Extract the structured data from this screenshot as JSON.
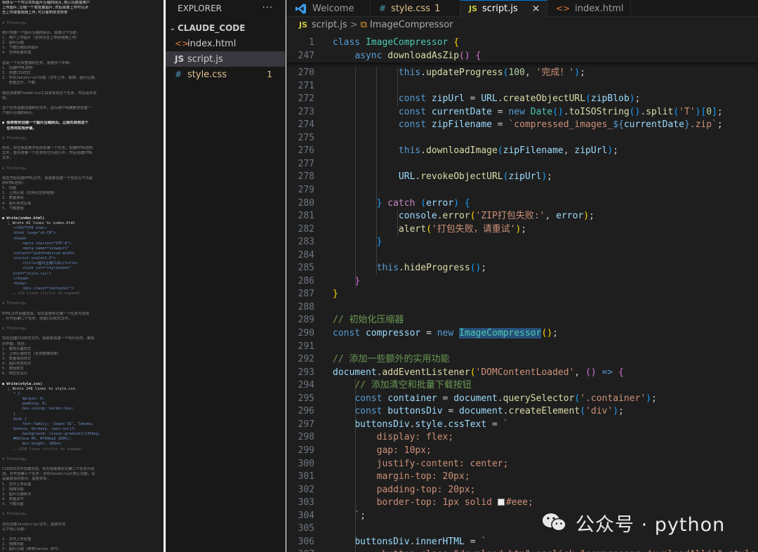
{
  "terminal": {
    "lines": [
      {
        "t": "我想写一个可以实现图片压缩的网页,核心功能需用户",
        "s": "st"
      },
      {
        "t": "上传图片,压缩一个或批量图片,然后需要上传可以点",
        "s": "st"
      },
      {
        "t": "击上传或者拖拽上传,可以看到预览效果",
        "s": "st"
      },
      {
        "t": "",
        "s": ""
      },
      {
        "t": "✻ Thinking…",
        "s": "dm"
      },
      {
        "t": "",
        "s": ""
      },
      {
        "t": "用户想要一个图片压缩的网页，需要以下功能:",
        "s": ""
      },
      {
        "t": "1. 用户上传图片（支持点击上传和拖拽上传）",
        "s": ""
      },
      {
        "t": "2. 图片压缩",
        "s": ""
      },
      {
        "t": "3. 下载压缩后的图片",
        "s": ""
      },
      {
        "t": "4. 支持批量处理",
        "s": ""
      },
      {
        "t": "",
        "s": ""
      },
      {
        "t": "这是一个比较直接的任务，需要多个步骤:",
        "s": ""
      },
      {
        "t": "1. 创建HTML结构",
        "s": ""
      },
      {
        "t": "2. 创建CSS样式",
        "s": ""
      },
      {
        "t": "3. 实现JavaScript功能（文件上传、拖拽、图片压缩、",
        "s": ""
      },
      {
        "t": "   质量显示、下载）",
        "s": ""
      },
      {
        "t": "",
        "s": ""
      },
      {
        "t": "我应该使用TodoWrite工具来规划这个任务，然后逐步实",
        "s": ""
      },
      {
        "t": "现。",
        "s": ""
      },
      {
        "t": "",
        "s": ""
      },
      {
        "t": "这个任务需要创建新的文件，因为用户明确要求创建一",
        "s": ""
      },
      {
        "t": "个图片压缩的网页。",
        "s": ""
      },
      {
        "t": "",
        "s": ""
      },
      {
        "t": "● 我将帮你创建一个图片压缩网页。让我先规划这个",
        "s": "hd"
      },
      {
        "t": "  任务的实现步骤。",
        "s": "hd"
      },
      {
        "t": "",
        "s": ""
      },
      {
        "t": "✻ Thinking…",
        "s": "dm"
      },
      {
        "t": "",
        "s": ""
      },
      {
        "t": "好的，现在我需要开始实现第一个任务，创建HTML结构",
        "s": ""
      },
      {
        "t": "文件。首先将第一个任务标记为进行中，然后创建HTML",
        "s": ""
      },
      {
        "t": "文件。",
        "s": ""
      },
      {
        "t": "",
        "s": ""
      },
      {
        "t": "✻ Thinking…",
        "s": "dm"
      },
      {
        "t": "",
        "s": ""
      },
      {
        "t": "现在开始创建HTML文件。我需要创建一个包含以下元素",
        "s": ""
      },
      {
        "t": "的HTML结构:",
        "s": ""
      },
      {
        "t": "1. 标题",
        "s": ""
      },
      {
        "t": "2. 上传区域（支持点击和拖拽）",
        "s": ""
      },
      {
        "t": "3. 质量滑块",
        "s": ""
      },
      {
        "t": "4. 图片预览区域",
        "s": ""
      },
      {
        "t": "5. 下载按钮",
        "s": ""
      },
      {
        "t": "",
        "s": ""
      },
      {
        "t": "● Write(index.html)",
        "s": "hd"
      },
      {
        "t": "  ⎿ Wrote 42 lines to index.html",
        "s": "st"
      },
      {
        "t": "     <!DOCTYPE html>",
        "s": "cd"
      },
      {
        "t": "     <html lang=\"zh-CN\">",
        "s": "cd"
      },
      {
        "t": "     <head>",
        "s": "cd"
      },
      {
        "t": "         <meta charset=\"UTF-8\">",
        "s": "cd"
      },
      {
        "t": "         <meta name=\"viewport\"",
        "s": "cd"
      },
      {
        "t": "     content=\"width=device-width,",
        "s": "cd"
      },
      {
        "t": "     initial-scale=1.0\">",
        "s": "cd"
      },
      {
        "t": "         <title>图片压缩工具</title>",
        "s": "cd"
      },
      {
        "t": "         <link rel=\"stylesheet\"",
        "s": "cd"
      },
      {
        "t": "     href=\"style.css\">",
        "s": "cd"
      },
      {
        "t": "     </head>",
        "s": "cd"
      },
      {
        "t": "     <body>",
        "s": "cd"
      },
      {
        "t": "         <div class=\"container\">",
        "s": "cd"
      },
      {
        "t": "     … +32 lines (ctrl+r to expand)",
        "s": "dm"
      },
      {
        "t": "",
        "s": ""
      },
      {
        "t": "✻ Thinking…",
        "s": "dm"
      },
      {
        "t": "",
        "s": ""
      },
      {
        "t": "HTML文件创建完成。现在需要标记第一个任务为完成",
        "s": ""
      },
      {
        "t": "，并开始第二个任务：创建CSS样式文件。",
        "s": ""
      },
      {
        "t": "",
        "s": ""
      },
      {
        "t": "✻ Thinking…",
        "s": "dm"
      },
      {
        "t": "",
        "s": ""
      },
      {
        "t": "现在创建CSS样式文件。我需要创建一个现代化的、美观",
        "s": ""
      },
      {
        "t": "的界面，包括:",
        "s": ""
      },
      {
        "t": "1. 整体页面样式",
        "s": ""
      },
      {
        "t": "2. 上传区域样式（支持拖拽效果）",
        "s": ""
      },
      {
        "t": "3. 质量滑块样式",
        "s": ""
      },
      {
        "t": "4. 图片预览样式",
        "s": ""
      },
      {
        "t": "5. 按钮样式",
        "s": ""
      },
      {
        "t": "6. 响应式设计",
        "s": ""
      },
      {
        "t": "",
        "s": ""
      },
      {
        "t": "● Write(style.css)",
        "s": "hd"
      },
      {
        "t": "  ⎿ Wrote 248 lines to style.css",
        "s": "st"
      },
      {
        "t": "     * {",
        "s": "cd"
      },
      {
        "t": "         margin: 0;",
        "s": "cd"
      },
      {
        "t": "         padding: 0;",
        "s": "cd"
      },
      {
        "t": "         box-sizing: border-box;",
        "s": "cd"
      },
      {
        "t": "     }",
        "s": "cd"
      },
      {
        "t": "     body {",
        "s": "cd"
      },
      {
        "t": "         font-family: 'Segoe UI', Tahoma,",
        "s": "cd"
      },
      {
        "t": "     Geneva, Verdana, sans-serif;",
        "s": "cd"
      },
      {
        "t": "         background: linear-gradient(135deg,",
        "s": "cd"
      },
      {
        "t": "     #667eea 0%, #764ba2 100%);",
        "s": "cd"
      },
      {
        "t": "         min-height: 100vh;",
        "s": "cd"
      },
      {
        "t": "     … +238 lines (ctrl+r to expand)",
        "s": "dm"
      },
      {
        "t": "",
        "s": ""
      },
      {
        "t": "✻ Thinking…",
        "s": "dm"
      },
      {
        "t": "",
        "s": ""
      },
      {
        "t": "CSS样式文件创建完成。现在我需要标记第二个任务为完",
        "s": ""
      },
      {
        "t": "成，并开始第三个任务：实现JavaScript核心功能。这",
        "s": ""
      },
      {
        "t": "是最复杂的部分，需要实现:",
        "s": ""
      },
      {
        "t": "1. 文件上传处理",
        "s": ""
      },
      {
        "t": "2. 拖拽功能",
        "s": ""
      },
      {
        "t": "3. 图片压缩算法",
        "s": ""
      },
      {
        "t": "4. 质量调节",
        "s": ""
      },
      {
        "t": "5. 下载功能",
        "s": ""
      },
      {
        "t": "",
        "s": ""
      },
      {
        "t": "✻ Thinking…",
        "s": "dm"
      },
      {
        "t": "",
        "s": ""
      },
      {
        "t": "现在创建JavaScript文件，需要实现",
        "s": ""
      },
      {
        "t": "以下核心功能:",
        "s": ""
      },
      {
        "t": "",
        "s": ""
      },
      {
        "t": "1. 文件上传处理",
        "s": ""
      },
      {
        "t": "2. 拖拽功能",
        "s": ""
      },
      {
        "t": "3. 图片压缩（使用Canvas API）",
        "s": ""
      },
      {
        "t": "4. 质量调节",
        "s": ""
      },
      {
        "t": "5. 下载功能",
        "s": ""
      },
      {
        "t": "",
        "s": ""
      },
      {
        "t": "这是一个比较复杂的JavaScript文件",
        "s": ""
      },
      {
        "t": "，我需要仔细编写所有功能。",
        "s": ""
      }
    ]
  },
  "explorer": {
    "title": "EXPLORER",
    "more": "···",
    "folder": "CLAUDE_CODE",
    "files": [
      {
        "name": "index.html",
        "icon": "<>",
        "kind": "html",
        "active": false,
        "modified": false,
        "badge": ""
      },
      {
        "name": "script.js",
        "icon": "JS",
        "kind": "js",
        "active": true,
        "modified": false,
        "badge": ""
      },
      {
        "name": "style.css",
        "icon": "#",
        "kind": "css",
        "active": false,
        "modified": true,
        "badge": "1"
      }
    ]
  },
  "tabs": [
    {
      "label": "Welcome",
      "icon": "vscode-logo-icon",
      "active": false,
      "modified": false,
      "badge": ""
    },
    {
      "label": "style.css",
      "icon": "#",
      "active": false,
      "modified": true,
      "badge": "1"
    },
    {
      "label": "script.js",
      "icon": "JS",
      "active": true,
      "modified": false,
      "badge": ""
    },
    {
      "label": "index.html",
      "icon": "<>",
      "active": false,
      "modified": false,
      "badge": ""
    }
  ],
  "breadcrumb": {
    "file": "script.js",
    "file_icon": "JS",
    "separator": ">",
    "symbol": "ImageCompressor"
  },
  "editor": {
    "sticky": [
      {
        "num": "1",
        "html": "<span class=\"k\">class</span> <span class=\"c\">ImageCompressor</span> <span class=\"b1\">{</span>"
      },
      {
        "num": "247",
        "html": "    <span class=\"k\">async</span> <span class=\"f\">downloadAsZip</span><span class=\"b2\">()</span> <span class=\"b2\">{</span>"
      }
    ],
    "lines": [
      {
        "num": "270",
        "html": "            <span class=\"k\">this</span>.<span class=\"f\">updateProgress</span><span class=\"b3\">(</span><span class=\"n\">100</span>, <span class=\"s\">'完成！'</span><span class=\"b3\">)</span>;"
      },
      {
        "num": "271",
        "html": ""
      },
      {
        "num": "272",
        "html": "            <span class=\"k\">const</span> <span class=\"v\">zipUrl</span> = <span class=\"v\">URL</span>.<span class=\"f\">createObjectURL</span><span class=\"b3\">(</span><span class=\"v\">zipBlob</span><span class=\"b3\">)</span>;"
      },
      {
        "num": "273",
        "html": "            <span class=\"k\">const</span> <span class=\"v\">currentDate</span> = <span class=\"k\">new</span> <span class=\"c\">Date</span><span class=\"b3\">()</span>.<span class=\"f\">toISOString</span><span class=\"b3\">()</span>.<span class=\"f\">split</span><span class=\"b3\">(</span><span class=\"s\">'T'</span><span class=\"b3\">)</span><span class=\"b3\">[</span><span class=\"n\">0</span><span class=\"b3\">]</span>;"
      },
      {
        "num": "274",
        "html": "            <span class=\"k\">const</span> <span class=\"v\">zipFilename</span> = <span class=\"s\">`compressed_images_</span><span class=\"k\">${</span><span class=\"v\">currentDate</span><span class=\"k\">}</span><span class=\"s\">.zip`</span>;"
      },
      {
        "num": "275",
        "html": ""
      },
      {
        "num": "276",
        "html": "            <span class=\"k\">this</span>.<span class=\"f\">downloadImage</span><span class=\"b3\">(</span><span class=\"v\">zipFilename</span>, <span class=\"v\">zipUrl</span><span class=\"b3\">)</span>;"
      },
      {
        "num": "277",
        "html": ""
      },
      {
        "num": "278",
        "html": "            <span class=\"v\">URL</span>.<span class=\"f\">revokeObjectURL</span><span class=\"b3\">(</span><span class=\"v\">zipUrl</span><span class=\"b3\">)</span>;"
      },
      {
        "num": "279",
        "html": ""
      },
      {
        "num": "280",
        "html": "        <span class=\"b3\">}</span> <span class=\"kc\">catch</span> <span class=\"b3\">(</span><span class=\"v\">error</span><span class=\"b3\">)</span> <span class=\"b3\">{</span>"
      },
      {
        "num": "281",
        "html": "            <span class=\"v\">console</span>.<span class=\"f\">error</span><span class=\"b1\">(</span><span class=\"s\">'ZIP打包失败:'</span>, <span class=\"v\">error</span><span class=\"b1\">)</span>;"
      },
      {
        "num": "282",
        "html": "            <span class=\"f\">alert</span><span class=\"b1\">(</span><span class=\"s\">'打包失败，请重试'</span><span class=\"b1\">)</span>;"
      },
      {
        "num": "283",
        "html": "        <span class=\"b3\">}</span>"
      },
      {
        "num": "284",
        "html": ""
      },
      {
        "num": "285",
        "html": "        <span class=\"k\">this</span>.<span class=\"f\">hideProgress</span><span class=\"b3\">()</span>;"
      },
      {
        "num": "286",
        "html": "    <span class=\"b2\">}</span>"
      },
      {
        "num": "287",
        "html": "<span class=\"b1\">}</span>"
      },
      {
        "num": "288",
        "html": ""
      },
      {
        "num": "289",
        "html": "<span class=\"cm\">// 初始化压缩器</span>"
      },
      {
        "num": "290",
        "html": "<span class=\"k\">const</span> <span class=\"v\">compressor</span> = <span class=\"k\">new</span> <span class=\"c hl\">ImageCompressor</span><span class=\"b1\">()</span>;"
      },
      {
        "num": "291",
        "html": ""
      },
      {
        "num": "292",
        "html": "<span class=\"cm\">// 添加一些额外的实用功能</span>"
      },
      {
        "num": "293",
        "html": "<span class=\"v\">document</span>.<span class=\"f\">addEventListener</span><span class=\"b1\">(</span><span class=\"s\">'DOMContentLoaded'</span>, <span class=\"b2\">()</span> <span class=\"k\">=&gt;</span> <span class=\"b2\">{</span>"
      },
      {
        "num": "294",
        "html": "    <span class=\"cm\">// 添加清空和批量下载按钮</span>"
      },
      {
        "num": "295",
        "html": "    <span class=\"k\">const</span> <span class=\"v\">container</span> = <span class=\"v\">document</span>.<span class=\"f\">querySelector</span><span class=\"b3\">(</span><span class=\"s\">'.container'</span><span class=\"b3\">)</span>;"
      },
      {
        "num": "296",
        "html": "    <span class=\"k\">const</span> <span class=\"v\">buttonsDiv</span> = <span class=\"v\">document</span>.<span class=\"f\">createElement</span><span class=\"b3\">(</span><span class=\"s\">'div'</span><span class=\"b3\">)</span>;"
      },
      {
        "num": "297",
        "html": "    <span class=\"v\">buttonsDiv</span>.<span class=\"v\">style</span>.<span class=\"v\">cssText</span> = <span class=\"s\">`</span>"
      },
      {
        "num": "298",
        "html": "<span class=\"s\">        display: flex;</span>"
      },
      {
        "num": "299",
        "html": "<span class=\"s\">        gap: 10px;</span>"
      },
      {
        "num": "300",
        "html": "<span class=\"s\">        justify-content: center;</span>"
      },
      {
        "num": "301",
        "html": "<span class=\"s\">        margin-top: 20px;</span>"
      },
      {
        "num": "302",
        "html": "<span class=\"s\">        padding-top: 20px;</span>"
      },
      {
        "num": "303",
        "html": "<span class=\"s\">        border-top: 1px solid </span><span style=\"display:inline-block;width:10px;height:10px;background:#eeeeee;border:1px solid #999;vertical-align:-1px;margin-right:2px\"></span><span class=\"s\">#eee;</span>"
      },
      {
        "num": "304",
        "html": "<span class=\"s\">    `</span>;"
      },
      {
        "num": "305",
        "html": ""
      },
      {
        "num": "306",
        "html": "    <span class=\"v\">buttonsDiv</span>.<span class=\"v\">innerHTML</span> = <span class=\"s\">`</span>"
      },
      {
        "num": "307",
        "html": "<span class=\"s\">        &lt;button class=\"download-btn\" onclick=\"compressor.downloadAll()\" style=\"b</span>"
      }
    ]
  },
  "watermark": {
    "text": "公众号 · python",
    "icon": "wechat-icon"
  }
}
